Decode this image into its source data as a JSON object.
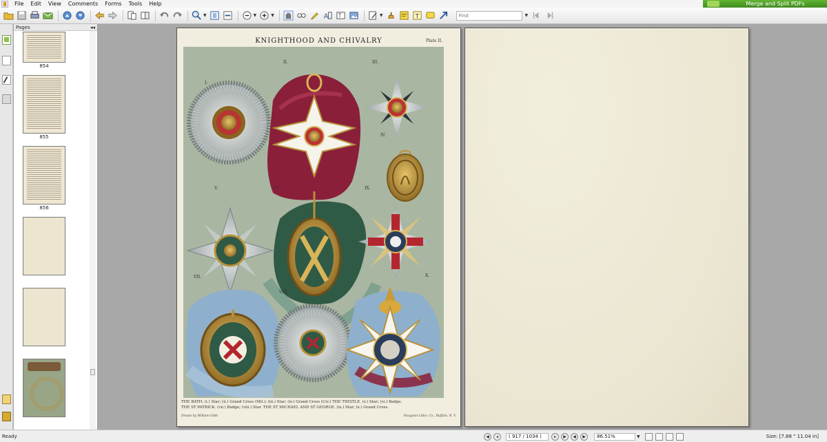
{
  "menu": {
    "items": [
      "File",
      "Edit",
      "View",
      "Comments",
      "Forms",
      "Tools",
      "Help"
    ]
  },
  "banner": {
    "label": "Merge and Split PDFs"
  },
  "toolbar": {
    "icons": [
      "open-icon",
      "save-icon",
      "print-icon",
      "email-icon",
      "prev-page-icon",
      "next-page-icon",
      "back-icon",
      "forward-icon",
      "extract-pages-icon",
      "combine-icon",
      "undo-icon",
      "redo-icon",
      "zoom-in-icon",
      "fit-page-icon",
      "fit-width-icon",
      "zoom-out-icon",
      "zoom-in-plus-icon",
      "hand-tool-icon",
      "snapshot-icon",
      "highlight-icon",
      "select-text-icon",
      "typewriter-icon",
      "image-icon",
      "edit-icon",
      "stamp-icon",
      "note-icon",
      "text-box-icon",
      "comment-icon",
      "arrow-icon"
    ],
    "find_placeholder": "Find"
  },
  "pages_panel": {
    "title": "Pages",
    "thumbnails": [
      {
        "label": "854",
        "kind": "text"
      },
      {
        "label": "855",
        "kind": "text"
      },
      {
        "label": "856",
        "kind": "text"
      },
      {
        "label": "",
        "kind": "blank"
      },
      {
        "label": "",
        "kind": "blank"
      },
      {
        "label": "",
        "kind": "plate"
      }
    ]
  },
  "document": {
    "plate_title": "KNIGHTHOOD AND CHIVALRY",
    "plate_number": "Plate II.",
    "numerals": [
      "I.",
      "II.",
      "III.",
      "IV.",
      "V.",
      "VI.",
      "IX.",
      "VII.",
      "VIII.",
      "X."
    ],
    "caption_line1": "THE BATH.   (i.) Star;  (ii.) Grand Cross (Mil.);  (iii.) Star;  (iv.) Grand Cross (Civ.)   THE THISTLE.   (v.) Star;  (vi.) Badge.",
    "caption_line2": "THE ST PATRICK.   (vii.) Badge;  (viii.) Star.   THE ST MICHAEL AND ST GEORGE.   (ix.) Star;  (x.) Grand Cross.",
    "credit_left": "Drawn by William Gibb",
    "credit_right": "Hoagwin Litho. Co., Buffalo, N. Y."
  },
  "status": {
    "ready": "Ready",
    "page_indicator": "( 917 / 1034 )",
    "zoom": "86.51%",
    "size": "Size: [7.88 \" 11.04 in]"
  },
  "colors": {
    "accent_green": "#4e9f28",
    "plate_background": "#a9b6a2",
    "crimson_ribbon": "#8a1f3a",
    "teal_ribbon": "#2f5a45",
    "blue_ribbon": "#8fb0cc",
    "gold": "#b8923a"
  }
}
